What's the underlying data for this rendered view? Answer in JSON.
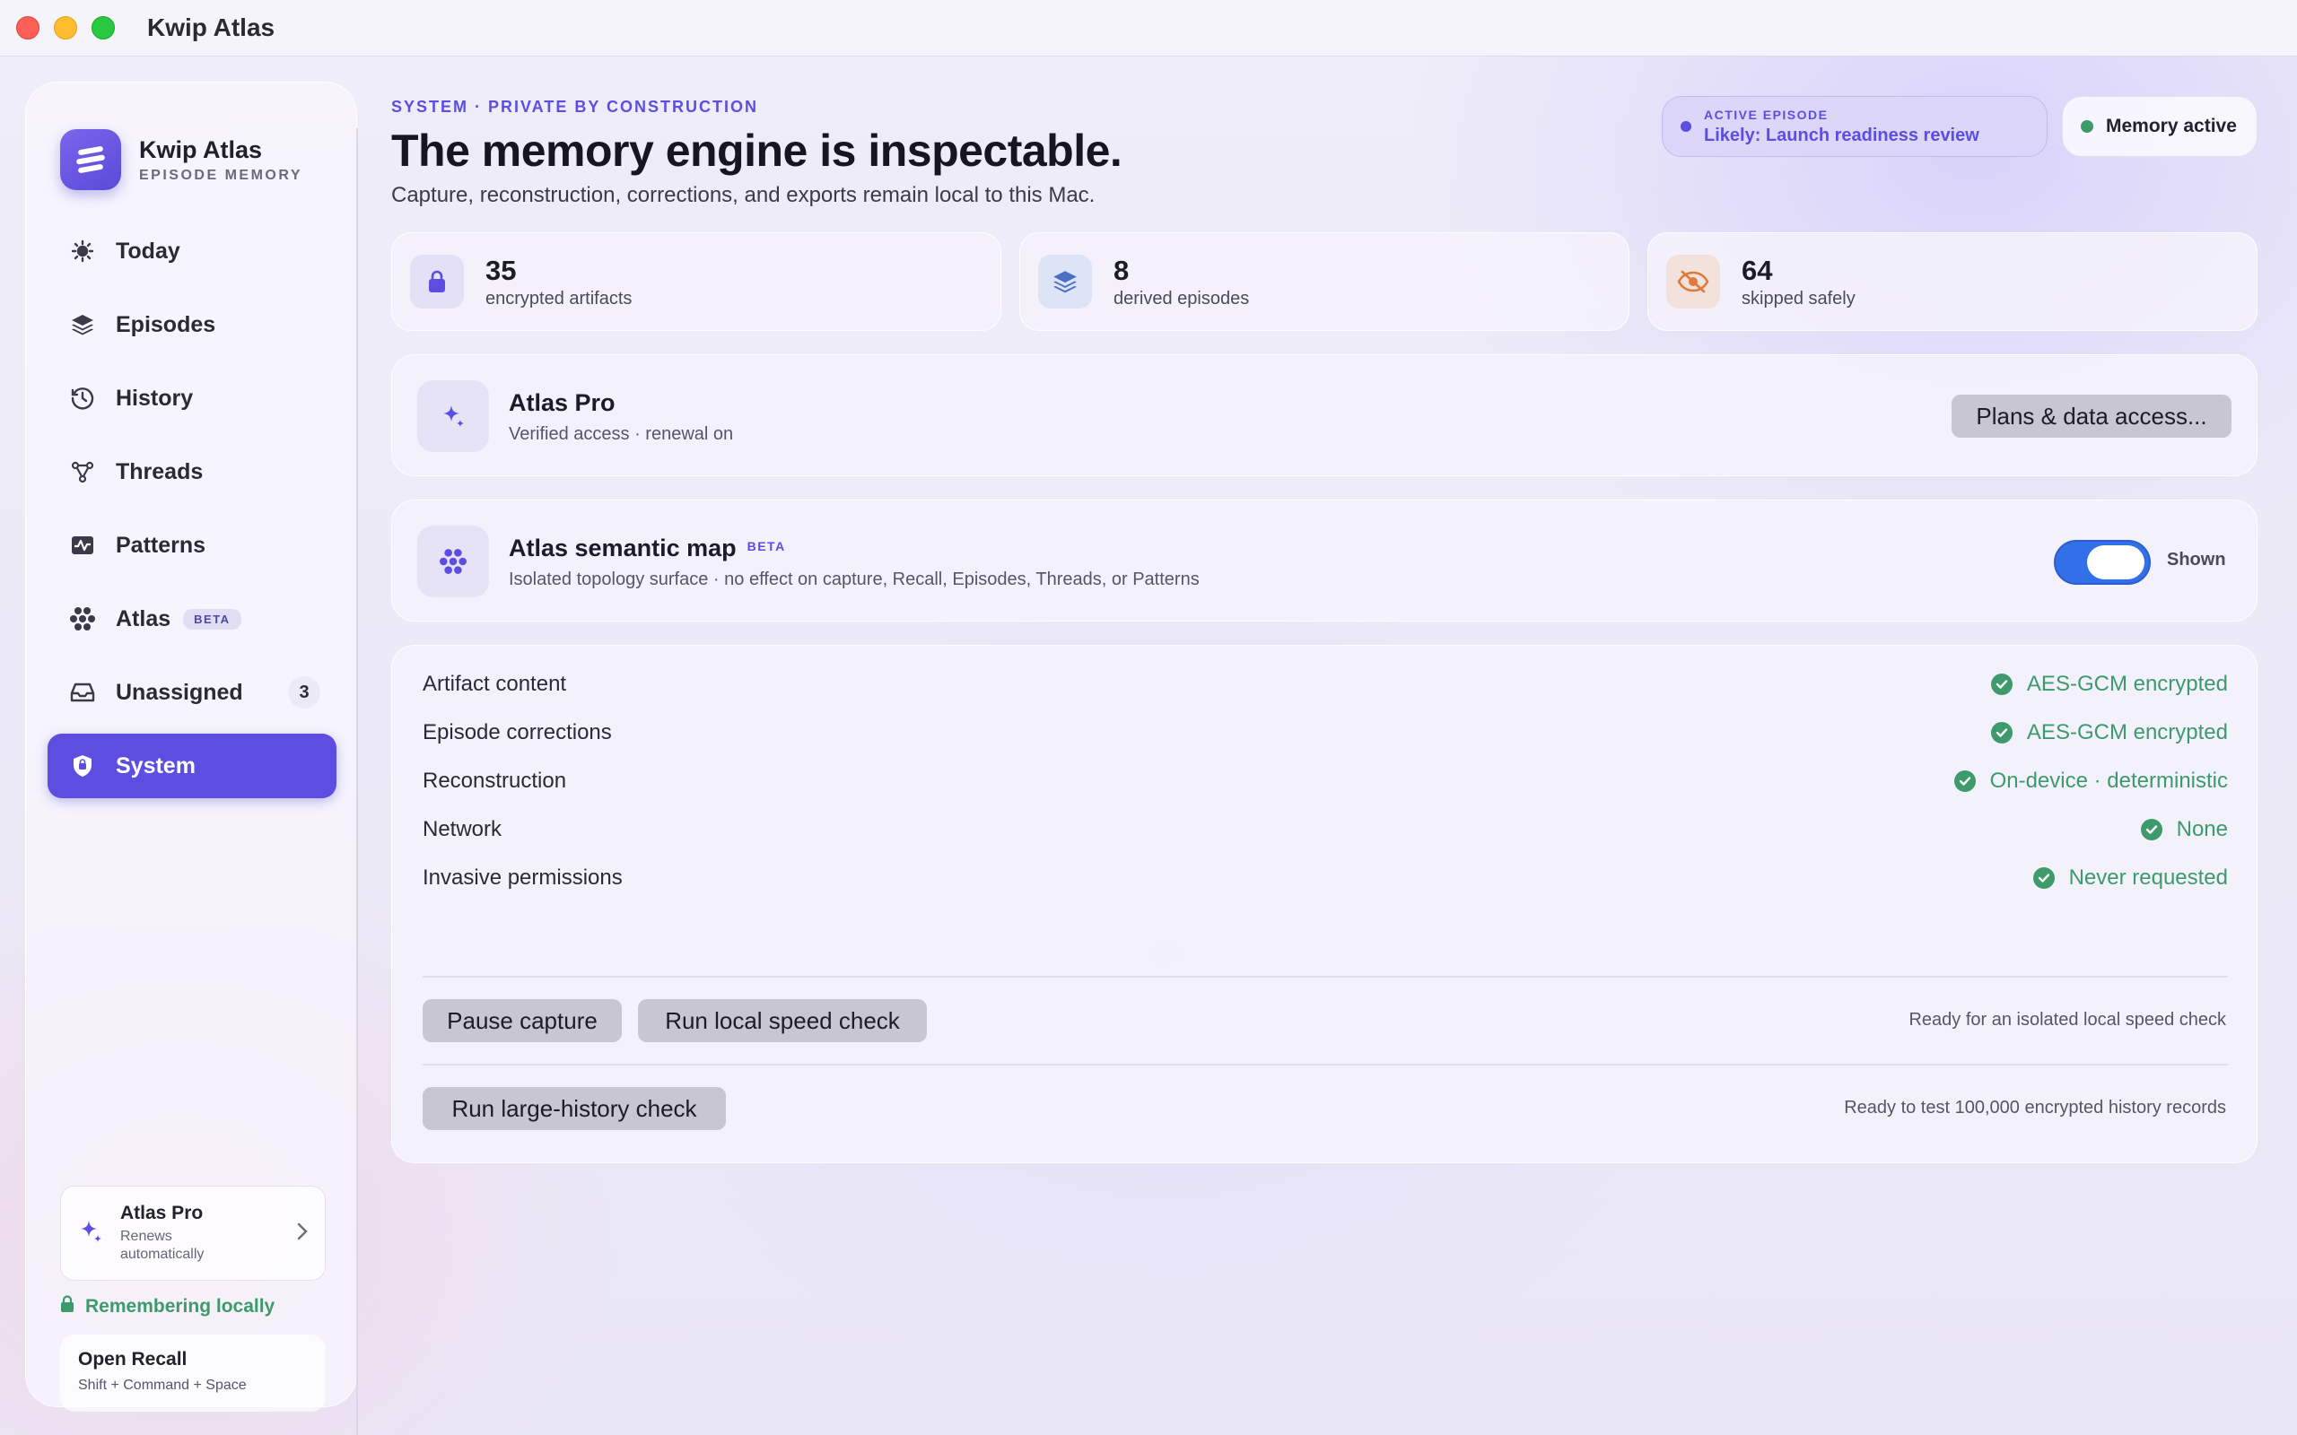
{
  "window": {
    "title": "Kwip Atlas"
  },
  "brand": {
    "name": "Kwip Atlas",
    "subtitle": "EPISODE MEMORY"
  },
  "nav": {
    "items": [
      {
        "label": "Today",
        "icon": "sun-icon"
      },
      {
        "label": "Episodes",
        "icon": "layers-icon"
      },
      {
        "label": "History",
        "icon": "history-clock-icon"
      },
      {
        "label": "Threads",
        "icon": "threads-graph-icon"
      },
      {
        "label": "Patterns",
        "icon": "pulse-chart-icon"
      },
      {
        "label": "Atlas",
        "icon": "atlas-cluster-icon",
        "badge": "BETA"
      },
      {
        "label": "Unassigned",
        "icon": "inbox-tray-icon",
        "count": "3"
      },
      {
        "label": "System",
        "icon": "shield-icon",
        "active": true
      }
    ]
  },
  "sidebar_footer": {
    "pro_title": "Atlas Pro",
    "pro_subtitle": "Renews automatically",
    "remember_text": "Remembering locally",
    "recall_title": "Open Recall",
    "recall_shortcut": "Shift + Command + Space"
  },
  "header": {
    "eyebrow": "SYSTEM · PRIVATE BY CONSTRUCTION",
    "title": "The memory engine is inspectable.",
    "subtitle": "Capture, reconstruction, corrections, and exports remain local to this Mac.",
    "episode_label": "ACTIVE EPISODE",
    "episode_value": "Likely: Launch readiness review",
    "memory_status": "Memory active"
  },
  "stats": [
    {
      "value": "35",
      "label": "encrypted artifacts",
      "icon": "lock-icon"
    },
    {
      "value": "8",
      "label": "derived episodes",
      "icon": "layers-icon"
    },
    {
      "value": "64",
      "label": "skipped safely",
      "icon": "eye-slash-icon"
    }
  ],
  "pro_panel": {
    "title": "Atlas Pro",
    "subtitle": "Verified access · renewal on",
    "button": "Plans & data access..."
  },
  "semantic_map": {
    "title": "Atlas semantic map",
    "badge": "BETA",
    "subtitle": "Isolated topology surface · no effect on capture, Recall, Episodes, Threads, or Patterns",
    "toggle_label": "Shown",
    "toggle_on": true
  },
  "security": {
    "rows": [
      {
        "label": "Artifact content",
        "value": "AES-GCM encrypted"
      },
      {
        "label": "Episode corrections",
        "value": "AES-GCM encrypted"
      },
      {
        "label": "Reconstruction",
        "value": "On-device · deterministic"
      },
      {
        "label": "Network",
        "value": "None"
      },
      {
        "label": "Invasive permissions",
        "value": "Never requested"
      }
    ],
    "pause_button": "Pause capture",
    "speed_button": "Run local speed check",
    "speed_status": "Ready for an isolated local speed check",
    "history_button": "Run large-history check",
    "history_status": "Ready to test 100,000 encrypted history records"
  },
  "colors": {
    "accent": "#5b4ee0",
    "success": "#3d9a6a",
    "toggle": "#3170e8"
  }
}
